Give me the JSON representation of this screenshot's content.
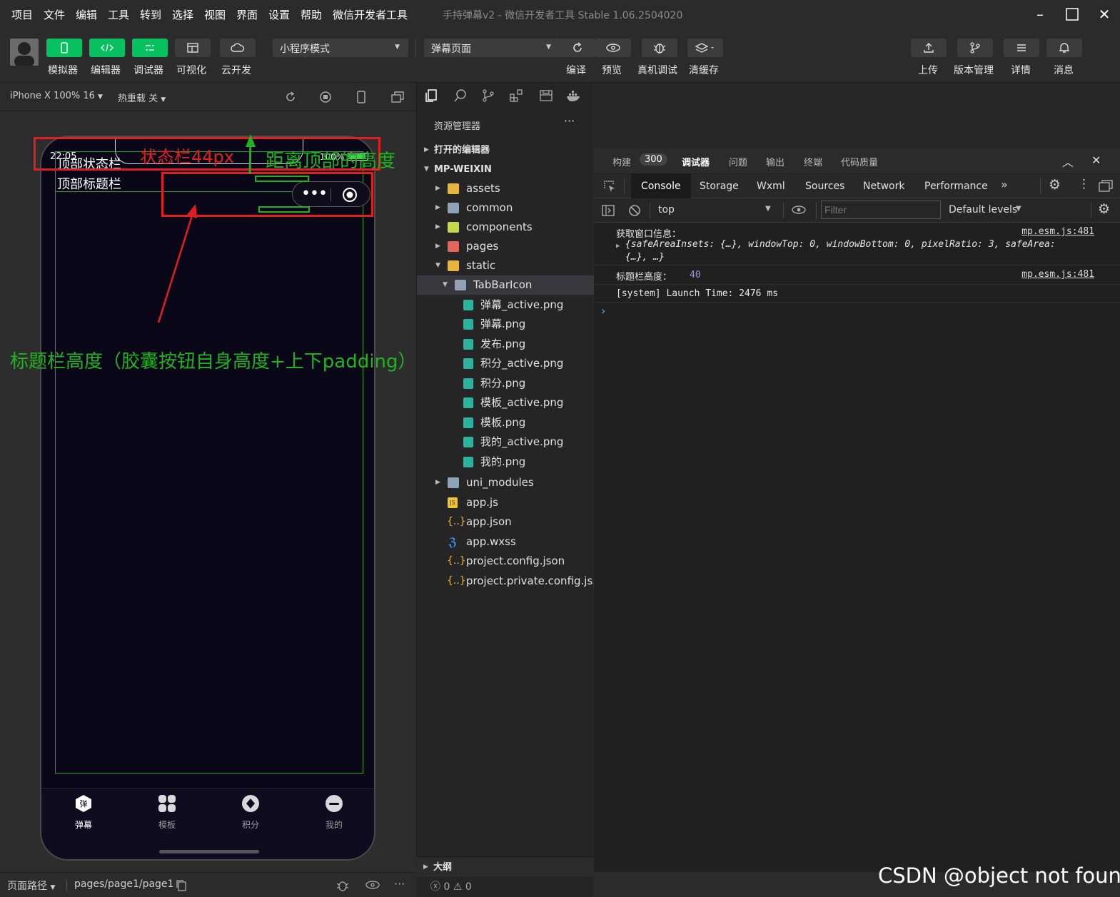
{
  "menubar": {
    "items": [
      "项目",
      "文件",
      "编辑",
      "工具",
      "转到",
      "选择",
      "视图",
      "界面",
      "设置",
      "帮助",
      "微信开发者工具"
    ],
    "title": "手持弹幕v2 - 微信开发者工具 Stable 1.06.2504020"
  },
  "toolbar": {
    "left_buttons": [
      {
        "label": "模拟器",
        "icon": "phone-icon",
        "active": true
      },
      {
        "label": "编辑器",
        "icon": "code-icon",
        "active": true
      },
      {
        "label": "调试器",
        "icon": "debug-icon",
        "active": true
      },
      {
        "label": "可视化",
        "icon": "layout-icon",
        "active": false
      },
      {
        "label": "云开发",
        "icon": "cloud-icon",
        "active": false
      }
    ],
    "mode_select": "小程序模式",
    "page_select": "弹幕页面",
    "mid_buttons": [
      {
        "label": "编译",
        "icon": "refresh-icon"
      },
      {
        "label": "预览",
        "icon": "eye-icon"
      },
      {
        "label": "真机调试",
        "icon": "bug-icon"
      },
      {
        "label": "清缓存",
        "icon": "layers-icon"
      }
    ],
    "right_buttons": [
      {
        "label": "上传",
        "icon": "upload-icon"
      },
      {
        "label": "版本管理",
        "icon": "branch-icon"
      },
      {
        "label": "详情",
        "icon": "menu-icon"
      },
      {
        "label": "消息",
        "icon": "bell-icon"
      }
    ]
  },
  "simulator": {
    "device": "iPhone X 100% 16",
    "hot_reload": "热重载 关",
    "status_time": "22:05",
    "status_battery": "100%",
    "overlay_status_label": "顶部状态栏",
    "overlay_title_label": "顶部标题栏",
    "tabs": [
      {
        "label": "弹幕",
        "icon": "danmu-icon",
        "active": true
      },
      {
        "label": "模板",
        "icon": "grid-icon",
        "active": false
      },
      {
        "label": "积分",
        "icon": "points-icon",
        "active": false
      },
      {
        "label": "我的",
        "icon": "profile-icon",
        "active": false
      }
    ],
    "page_path_label": "页面路径",
    "page_path": "pages/page1/page1"
  },
  "annotations": {
    "status_bar": "状态栏44px",
    "top_distance": "距离顶部的高度",
    "title_height": "标题栏高度（胶囊按钮自身高度+上下padding）"
  },
  "explorer": {
    "title": "资源管理器",
    "open_editors": "打开的编辑器",
    "root": "MP-WEIXIN",
    "items": [
      {
        "label": "assets",
        "type": "folder"
      },
      {
        "label": "common",
        "type": "folder"
      },
      {
        "label": "components",
        "type": "folder"
      },
      {
        "label": "pages",
        "type": "folder"
      },
      {
        "label": "static",
        "type": "folder"
      },
      {
        "label": "TabBarIcon",
        "type": "folder"
      },
      {
        "label": "弹幕_active.png",
        "type": "image"
      },
      {
        "label": "弹幕.png",
        "type": "image"
      },
      {
        "label": "发布.png",
        "type": "image"
      },
      {
        "label": "积分_active.png",
        "type": "image"
      },
      {
        "label": "积分.png",
        "type": "image"
      },
      {
        "label": "模板_active.png",
        "type": "image"
      },
      {
        "label": "模板.png",
        "type": "image"
      },
      {
        "label": "我的_active.png",
        "type": "image"
      },
      {
        "label": "我的.png",
        "type": "image"
      },
      {
        "label": "uni_modules",
        "type": "folder"
      },
      {
        "label": "app.js",
        "type": "js"
      },
      {
        "label": "app.json",
        "type": "json"
      },
      {
        "label": "app.wxss",
        "type": "css"
      },
      {
        "label": "project.config.json",
        "type": "json"
      },
      {
        "label": "project.private.config.js...",
        "type": "json"
      }
    ],
    "outline": "大纲",
    "errors": "0",
    "warnings": "0"
  },
  "devtools": {
    "header_tabs": [
      "构建",
      "调试器",
      "问题",
      "输出",
      "终端",
      "代码质量"
    ],
    "build_count": "300",
    "tabs": [
      "Console",
      "Storage",
      "Wxml",
      "Sources",
      "Network",
      "Performance"
    ],
    "context": "top",
    "filter_placeholder": "Filter",
    "levels": "Default levels",
    "console_lines": [
      {
        "label": "获取窗口信息：",
        "source": "mp.esm.js:481",
        "detail": "{safeAreaInsets: {…}, windowTop: 0, windowBottom: 0, pixelRatio: 3, safeArea:",
        "detail2": "{…}, …}"
      },
      {
        "label": "标题栏高度：",
        "value": "40",
        "source": "mp.esm.js:481"
      },
      {
        "label": "[system] Launch Time: 2476 ms"
      }
    ]
  },
  "watermark": "CSDN @object not found",
  "colors": {
    "accent": "#07c160",
    "annotation_red": "#e02020",
    "annotation_green": "#1fb41f"
  }
}
